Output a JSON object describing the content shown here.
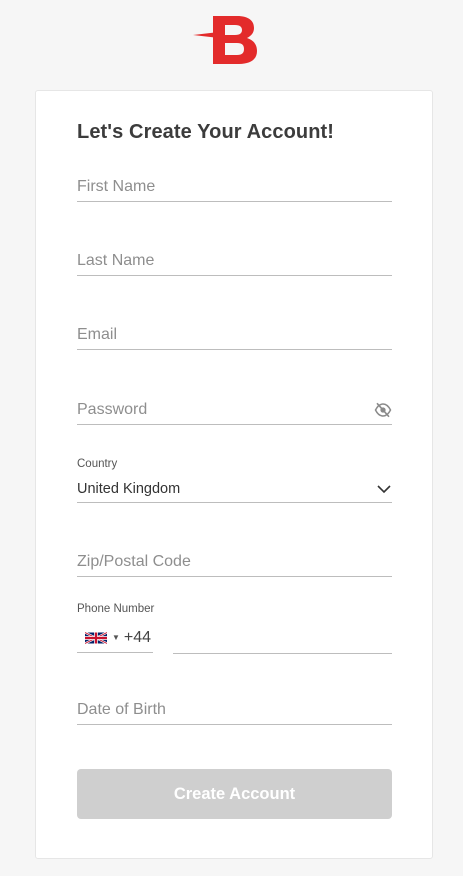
{
  "brand": {
    "logo_icon": "b-logo-icon",
    "accent": "#e32b2b"
  },
  "form": {
    "title": "Let's Create Your Account!",
    "first_name": {
      "placeholder": "First Name",
      "value": ""
    },
    "last_name": {
      "placeholder": "Last Name",
      "value": ""
    },
    "email": {
      "placeholder": "Email",
      "value": ""
    },
    "password": {
      "placeholder": "Password",
      "value": "",
      "toggle_icon": "eye-off-icon"
    },
    "country": {
      "label": "Country",
      "value": "United Kingdom",
      "icon": "chevron-down-icon"
    },
    "zip": {
      "placeholder": "Zip/Postal Code",
      "value": ""
    },
    "phone": {
      "label": "Phone Number",
      "flag_icon": "uk-flag-icon",
      "dial_code": "+44",
      "value": ""
    },
    "dob": {
      "placeholder": "Date of Birth",
      "value": ""
    },
    "submit_label": "Create Account",
    "submit_color": "#cfcfcf"
  }
}
